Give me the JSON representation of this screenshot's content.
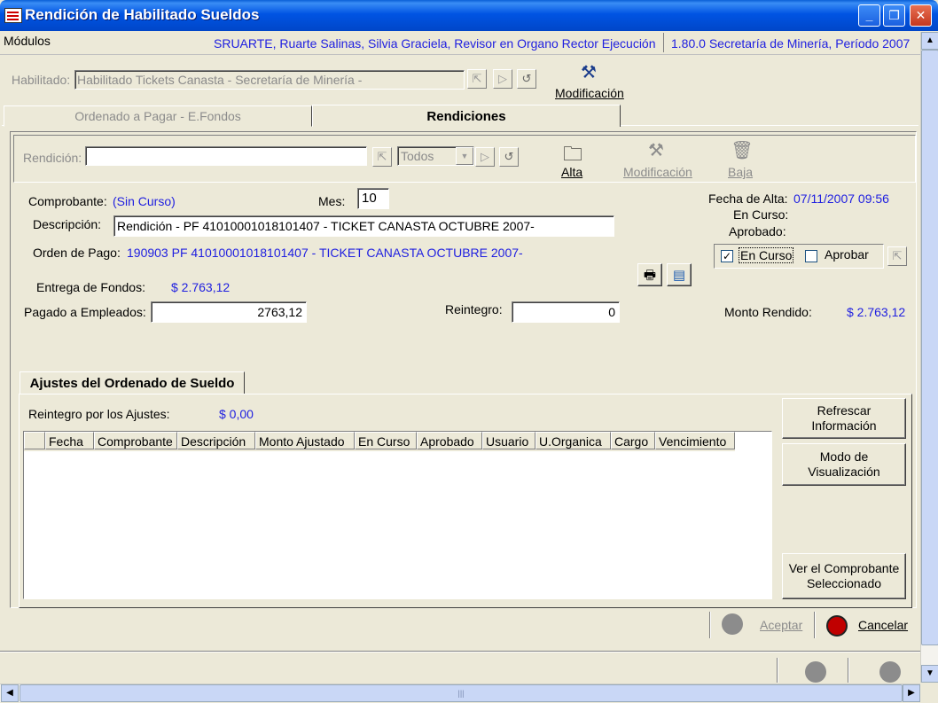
{
  "window": {
    "title": "Rendición de Habilitado Sueldos"
  },
  "menu": {
    "modules_label": "Módulos",
    "user_info": "SRUARTE, Ruarte Salinas, Silvia Graciela, Revisor en Organo Rector Ejecución",
    "version_info": "1.80.0 Secretaría de Minería, Período 2007"
  },
  "habilitado": {
    "label": "Habilitado:",
    "value": "Habilitado  Tickets Canasta - Secretaría de Minería -",
    "modificacion_label": "Modificación"
  },
  "tabs": [
    {
      "label": "Ordenado a Pagar - E.Fondos"
    },
    {
      "label": "Rendiciones"
    }
  ],
  "rendicion_toolbar": {
    "label": "Rendición:",
    "value": "",
    "filter_value": "Todos",
    "alta_label": "Alta",
    "modificacion_label": "Modificación",
    "baja_label": "Baja"
  },
  "form": {
    "comprobante_label": "Comprobante:",
    "comprobante_value": "(Sin Curso)",
    "mes_label": "Mes:",
    "mes_value": "10",
    "descripcion_label": "Descripción:",
    "descripcion_value": "Rendición - PF 41010001018101407 - TICKET CANASTA OCTUBRE 2007-",
    "orden_label": "Orden de Pago:",
    "orden_value": "190903 PF 41010001018101407 - TICKET CANASTA OCTUBRE 2007-",
    "entrega_label": "Entrega de Fondos:",
    "entrega_value": "$ 2.763,12",
    "pagado_label": "Pagado a Empleados:",
    "pagado_value": "2763,12",
    "reintegro_label": "Reintegro:",
    "reintegro_value": "0",
    "fecha_alta_label": "Fecha de Alta:",
    "fecha_alta_value": "07/11/2007 09:56",
    "en_curso_label": "En Curso:",
    "aprobado_label": "Aprobado:",
    "chk_en_curso_label": "En Curso",
    "chk_en_curso_checked": true,
    "chk_aprobar_label": "Aprobar",
    "chk_aprobar_checked": false,
    "monto_rendido_label": "Monto Rendido:",
    "monto_rendido_value": "$ 2.763,12"
  },
  "ajustes": {
    "tab_label": "Ajustes del Ordenado de Sueldo",
    "reintegro_label": "Reintegro por los Ajustes:",
    "reintegro_value": "$ 0,00",
    "columns": [
      "Fecha",
      "Comprobante",
      "Descripción",
      "Monto Ajustado",
      "En Curso",
      "Aprobado",
      "Usuario",
      "U.Organica",
      "Cargo",
      "Vencimiento"
    ],
    "refrescar_label": "Refrescar Información",
    "modo_label": "Modo de Visualización",
    "ver_label": "Ver el Comprobante Seleccionado"
  },
  "footer": {
    "aceptar_label": "Aceptar",
    "cancelar_label": "Cancelar"
  }
}
